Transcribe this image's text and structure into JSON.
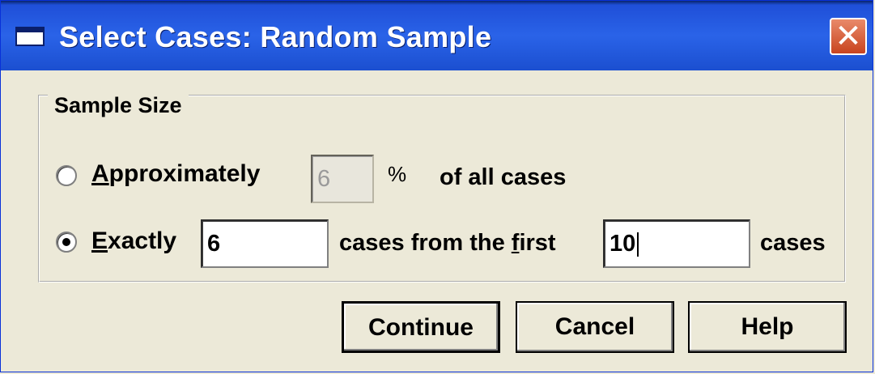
{
  "window": {
    "title": "Select Cases: Random Sample",
    "close_symbol": "✕"
  },
  "sample_size": {
    "legend": "Sample Size",
    "approximately": {
      "label_mnemonic": "A",
      "label_rest": "pproximately",
      "selected": false,
      "percent_value": "6",
      "percent_symbol": "%",
      "suffix": "of all cases"
    },
    "exactly": {
      "label_mnemonic": "E",
      "label_rest": "xactly",
      "selected": true,
      "count_value": "6",
      "middle_before": "cases from the ",
      "middle_mnemonic": "f",
      "middle_after": "irst",
      "total_value": "10",
      "suffix": "cases"
    }
  },
  "buttons": {
    "continue": "Continue",
    "cancel": "Cancel",
    "help": "Help"
  },
  "icons": {
    "window_icon": "window-icon",
    "close": "close-icon"
  }
}
